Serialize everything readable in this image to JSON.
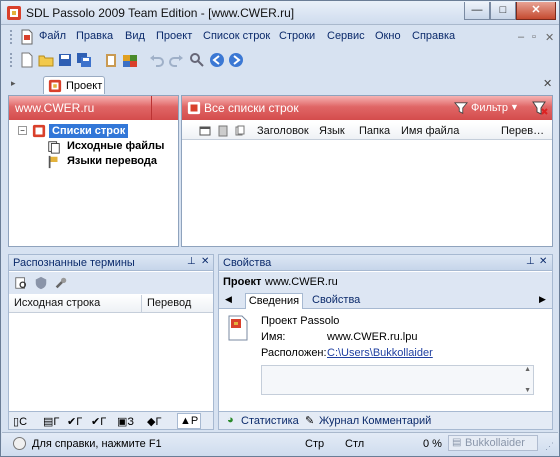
{
  "window": {
    "title": "SDL Passolo 2009 Team Edition - [www.CWER.ru]"
  },
  "menu": [
    "Файл",
    "Правка",
    "Вид",
    "Проект",
    "Список строк",
    "Строки",
    "Сервис",
    "Окно",
    "Справка"
  ],
  "document_tab": {
    "label": "Проект"
  },
  "project_panel": {
    "header": "www.CWER.ru",
    "tree": {
      "root": "Списки строк",
      "children": [
        "Исходные файлы",
        "Языки перевода"
      ]
    }
  },
  "strings_panel": {
    "header": "Все списки строк",
    "filter_label": "Фильтр",
    "columns": [
      "Заголовок",
      "Язык",
      "Папка",
      "Имя файла",
      "Перев…"
    ]
  },
  "terms_panel": {
    "title": "Распознанные термины",
    "columns": [
      "Исходная строка",
      "Перевод"
    ],
    "tab_labels": [
      "С",
      "Г",
      "Г",
      "Г",
      "З",
      "Г",
      "Р"
    ]
  },
  "props_panel": {
    "title": "Свойства",
    "project_label": "Проект",
    "project_value": "www.CWER.ru",
    "tabs": [
      "Сведения",
      "Свойства"
    ],
    "info_title": "Проект Passolo",
    "name_label": "Имя:",
    "name_value": "www.CWER.ru.lpu",
    "location_label": "Расположен:",
    "location_value": "C:\\Users\\Bukkollaider",
    "bottom_tabs": [
      "Статистика",
      "Журнал",
      "Комментарий"
    ]
  },
  "statusbar": {
    "help": "Для справки, нажмите F1",
    "str": "Стр",
    "col": "Стл",
    "percent": "0 %",
    "user": "Bukkollaider"
  }
}
